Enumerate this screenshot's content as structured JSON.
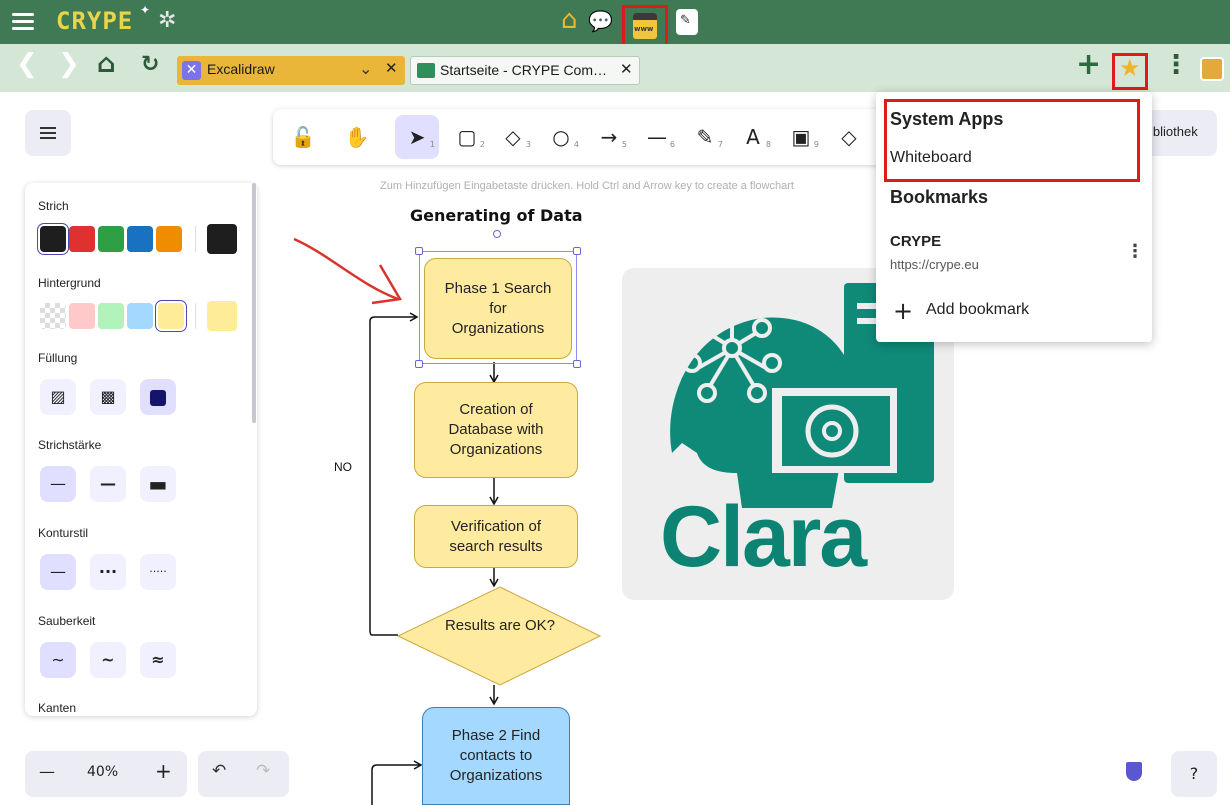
{
  "app": {
    "logo_text": "CRYPE",
    "toolbar_icons": [
      "menu-icon",
      "gear-icon",
      "home-icon",
      "chat-icon",
      "www-icon",
      "edit-icon"
    ],
    "www_label": "www"
  },
  "tabs": [
    {
      "label": "Excalidraw",
      "active": true
    },
    {
      "label": "Startseite - CRYPE Com…",
      "active": false
    }
  ],
  "excalidraw": {
    "hint": "Zum Hinzufügen Eingabetaste drücken. Hold Ctrl and Arrow key to create a flowchart",
    "library_label": "ibliothek",
    "tools": [
      {
        "name": "lock",
        "glyph": "🔓",
        "key": ""
      },
      {
        "name": "hand",
        "glyph": "✋",
        "key": ""
      },
      {
        "name": "selection",
        "glyph": "➤",
        "key": "1"
      },
      {
        "name": "rectangle",
        "glyph": "▢",
        "key": "2"
      },
      {
        "name": "diamond",
        "glyph": "◇",
        "key": "3"
      },
      {
        "name": "ellipse",
        "glyph": "○",
        "key": "4"
      },
      {
        "name": "arrow",
        "glyph": "→",
        "key": "5"
      },
      {
        "name": "line",
        "glyph": "—",
        "key": "6"
      },
      {
        "name": "draw",
        "glyph": "✎",
        "key": "7"
      },
      {
        "name": "text",
        "glyph": "A",
        "key": "8"
      },
      {
        "name": "image",
        "glyph": "▣",
        "key": "9"
      }
    ],
    "panel": {
      "stroke_label": "Strich",
      "background_label": "Hintergrund",
      "fill_label": "Füllung",
      "stroke_width_label": "Strichstärke",
      "stroke_style_label": "Konturstil",
      "sloppiness_label": "Sauberkeit",
      "edges_label": "Kanten",
      "stroke_colors": [
        "#1e1e1e",
        "#e03131",
        "#2f9e44",
        "#1971c2",
        "#f08c00"
      ],
      "stroke_current": "#1e1e1e",
      "bg_colors": [
        "transparent",
        "#ffc9c9",
        "#b2f2bb",
        "#a5d8ff",
        "#ffec99"
      ],
      "bg_current": "#ffec99"
    },
    "zoom": "40%"
  },
  "flowchart": {
    "title": "Generating of Data",
    "phase1": "Phase 1 Search for Organizations",
    "creation": "Creation of Database with Organizations",
    "verification": "Verification of search results",
    "decision": "Results are OK?",
    "no_label": "NO",
    "phase2": "Phase 2 Find contacts to Organizations"
  },
  "image_text": "Clara",
  "bookmarks_menu": {
    "system_apps_heading": "System Apps",
    "whiteboard": "Whiteboard",
    "bookmarks_heading": "Bookmarks",
    "bookmark_name": "CRYPE",
    "bookmark_url": "https://crype.eu",
    "add_bookmark": "Add bookmark"
  }
}
